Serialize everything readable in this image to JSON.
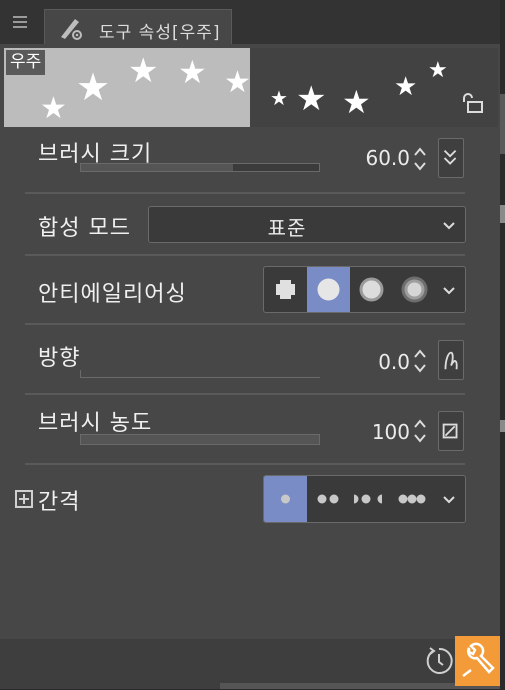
{
  "tab": {
    "menu_icon": "hamburger-icon",
    "tool_icon": "brush-settings-icon",
    "title": "도구 속성[우주]"
  },
  "preview": {
    "label": "우주",
    "lock_icon": "lock-open-icon"
  },
  "brush_size": {
    "label": "브러시 크기",
    "value": "60.0",
    "fill": 0.64,
    "side_icon": "double-chevron-down-icon"
  },
  "blend_mode": {
    "label": "합성 모드",
    "value": "표준",
    "icon": "chevron-down-icon"
  },
  "antialiasing": {
    "label": "안티에일리어싱",
    "selected_index": 1,
    "options": [
      "none",
      "weak",
      "medium",
      "strong"
    ]
  },
  "direction": {
    "label": "방향",
    "value": "0.0",
    "side_icon": "pen-pressure-icon"
  },
  "brush_density": {
    "label": "브러시 농도",
    "value": "100",
    "fill": 1.0,
    "side_icon": "no-dynamics-icon"
  },
  "spacing": {
    "label": "간격",
    "expand_icon": "plus-box-icon",
    "selected_index": 0,
    "options": [
      "narrow",
      "normal",
      "wide",
      "fixed"
    ]
  },
  "footer": {
    "reset_icon": "clock-reset-icon",
    "settings_icon": "wrench-icon"
  },
  "colors": {
    "accent_select": "#7a8cc6",
    "highlight": "#f29b38",
    "panel_bg": "#474747"
  }
}
